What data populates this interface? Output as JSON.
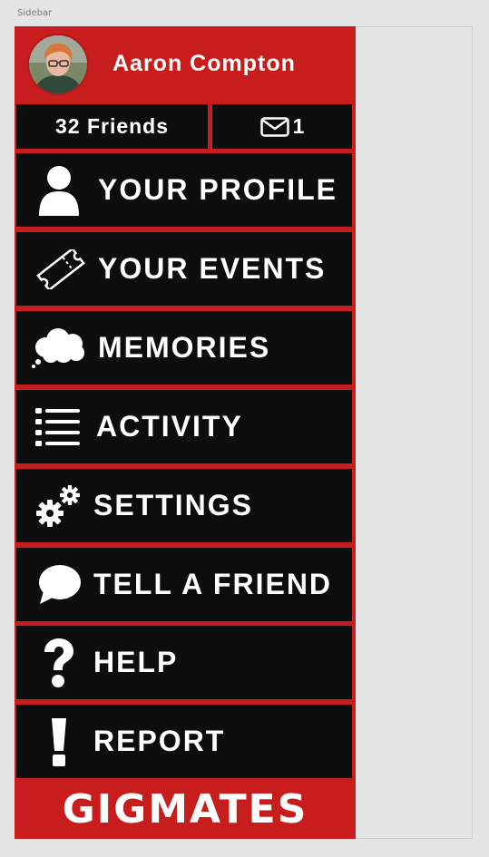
{
  "frame": {
    "label": "Sidebar"
  },
  "colors": {
    "brand_red": "#c81d1d",
    "item_bg": "#0d0d0d",
    "text": "#ffffff"
  },
  "user": {
    "name": "Aaron Compton",
    "avatar": "avatar"
  },
  "stats": {
    "friends_label": "32 Friends",
    "messages_count": "1",
    "messages_icon": "envelope-icon"
  },
  "menu": {
    "items": [
      {
        "label": "YOUR PROFILE",
        "icon": "person-icon"
      },
      {
        "label": "YOUR EVENTS",
        "icon": "ticket-icon"
      },
      {
        "label": "MEMORIES",
        "icon": "thought-cloud-icon"
      },
      {
        "label": "ACTIVITY",
        "icon": "list-icon"
      },
      {
        "label": "SETTINGS",
        "icon": "gears-icon"
      },
      {
        "label": "TELL A FRIEND",
        "icon": "speech-bubble-icon"
      },
      {
        "label": "HELP",
        "icon": "question-mark-icon"
      },
      {
        "label": "REPORT",
        "icon": "exclamation-icon"
      }
    ]
  },
  "footer": {
    "brand": "GIGMATES"
  }
}
